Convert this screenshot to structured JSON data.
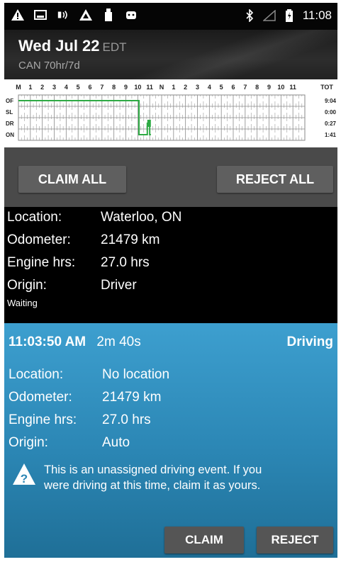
{
  "status_bar": {
    "time": "11:08",
    "left_icons": [
      "warning-icon",
      "image-icon",
      "nfc-icon",
      "warning-icon",
      "usb-icon",
      "android-icon"
    ],
    "right_icons": [
      "bluetooth-icon",
      "signal-icon",
      "battery-icon"
    ]
  },
  "header": {
    "date": "Wed Jul 22",
    "timezone": "EDT",
    "cycle": "CAN 70hr/7d"
  },
  "log_grid": {
    "hours": [
      "M",
      "1",
      "2",
      "3",
      "4",
      "5",
      "6",
      "7",
      "8",
      "9",
      "10",
      "11",
      "N",
      "1",
      "2",
      "3",
      "4",
      "5",
      "6",
      "7",
      "8",
      "9",
      "10",
      "11"
    ],
    "total_label": "TOT",
    "rows": [
      {
        "status": "OF",
        "total": "9:04"
      },
      {
        "status": "SL",
        "total": "0:00"
      },
      {
        "status": "DR",
        "total": "0:27"
      },
      {
        "status": "ON",
        "total": "1:41"
      }
    ],
    "line_color": "#2eaa44"
  },
  "actions": {
    "claim_all": "CLAIM ALL",
    "reject_all": "REJECT ALL"
  },
  "event1": {
    "location_label": "Location:",
    "location": "Waterloo, ON",
    "odometer_label": "Odometer:",
    "odometer": "21479 km",
    "engine_label": "Engine hrs:",
    "engine": "27.0 hrs",
    "origin_label": "Origin:",
    "origin": "Driver",
    "note": "Waiting"
  },
  "event2": {
    "time": "11:03:50 AM",
    "duration": "2m 40s",
    "type": "Driving",
    "location_label": "Location:",
    "location": "No location",
    "odometer_label": "Odometer:",
    "odometer": "21479 km",
    "engine_label": "Engine hrs:",
    "engine": "27.0 hrs",
    "origin_label": "Origin:",
    "origin": "Auto",
    "warning_line1": "This is an unassigned driving event. If you",
    "warning_line2": "were driving at this time, claim it as yours.",
    "claim": "CLAIM",
    "reject": "REJECT"
  },
  "colors": {
    "event_bg": "#2b86b4",
    "button_bg": "#5f5f5f",
    "bar_bg": "#4a4a4a"
  }
}
